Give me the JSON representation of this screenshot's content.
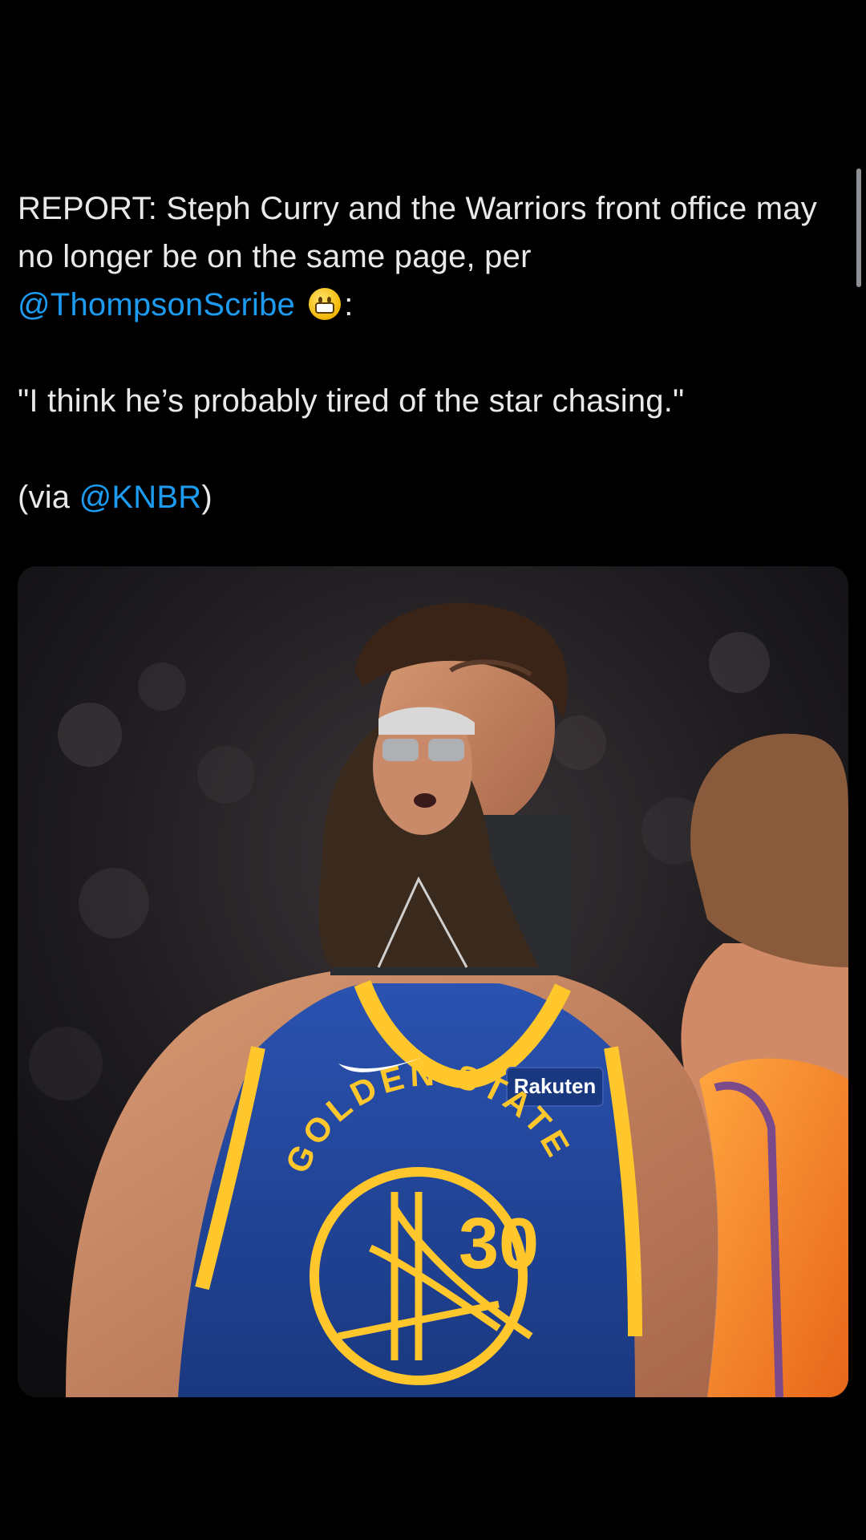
{
  "tweet": {
    "line1": "REPORT: Steph Curry and the Warriors front office may no longer be on the same page, per",
    "mention1": "@ThompsonScribe",
    "emoji_name": "grimacing-face-emoji",
    "after_emoji": ":",
    "quote": "\"I think he’s probably tired of the star chasing.\"",
    "via_prefix": "(via ",
    "mention2": "@KNBR",
    "via_suffix": ")"
  },
  "media": {
    "jersey_wordmark": "GOLDEN STATE",
    "jersey_number": "30",
    "sponsor_patch": "Rakuten",
    "colors": {
      "jersey_blue": "#1d428a",
      "jersey_gold": "#ffc72c",
      "opponent_orange": "#f07a1a"
    }
  },
  "colors": {
    "background": "#000000",
    "text": "#e7e9ea",
    "link": "#1d9bf0"
  }
}
